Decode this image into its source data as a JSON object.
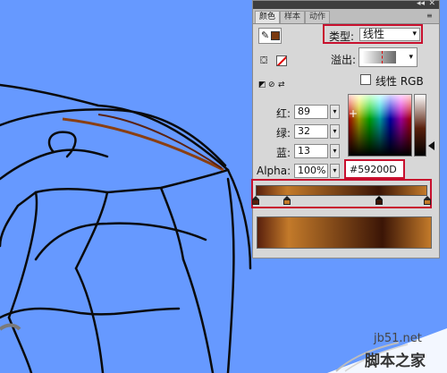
{
  "panel": {
    "tabs": [
      {
        "label": "颜色",
        "active": true
      },
      {
        "label": "样本",
        "active": false
      },
      {
        "label": "动作",
        "active": false
      }
    ],
    "collapse_glyph": "◂◂",
    "close_glyph": "✕",
    "menu_glyph": "≡",
    "stroke_icon": "pencil-icon",
    "stroke_color": "#7a3a10",
    "fill_icon": "paint-bucket-icon",
    "fill_color": "none",
    "type_label": "类型:",
    "type_value": "线性",
    "overflow_label": "溢出:",
    "linear_rgb_label": "线性 RGB",
    "channels": [
      {
        "label": "红:",
        "value": "89"
      },
      {
        "label": "绿:",
        "value": "32"
      },
      {
        "label": "蓝:",
        "value": "13"
      },
      {
        "label": "Alpha:",
        "value": "100%"
      }
    ],
    "hex_value": "#59200D",
    "gradient": {
      "stops": [
        {
          "position": 0.0,
          "color": "#59200D"
        },
        {
          "position": 0.18,
          "color": "#c37a2a"
        },
        {
          "position": 0.72,
          "color": "#3b1506"
        },
        {
          "position": 1.0,
          "color": "#c37a2a"
        }
      ]
    },
    "selected_stop_index": 2
  },
  "watermark": {
    "site": "jb51.net",
    "name": "脚本之家"
  },
  "colors": {
    "canvas_bg": "#6699ff",
    "accent_red": "#c8102e"
  }
}
